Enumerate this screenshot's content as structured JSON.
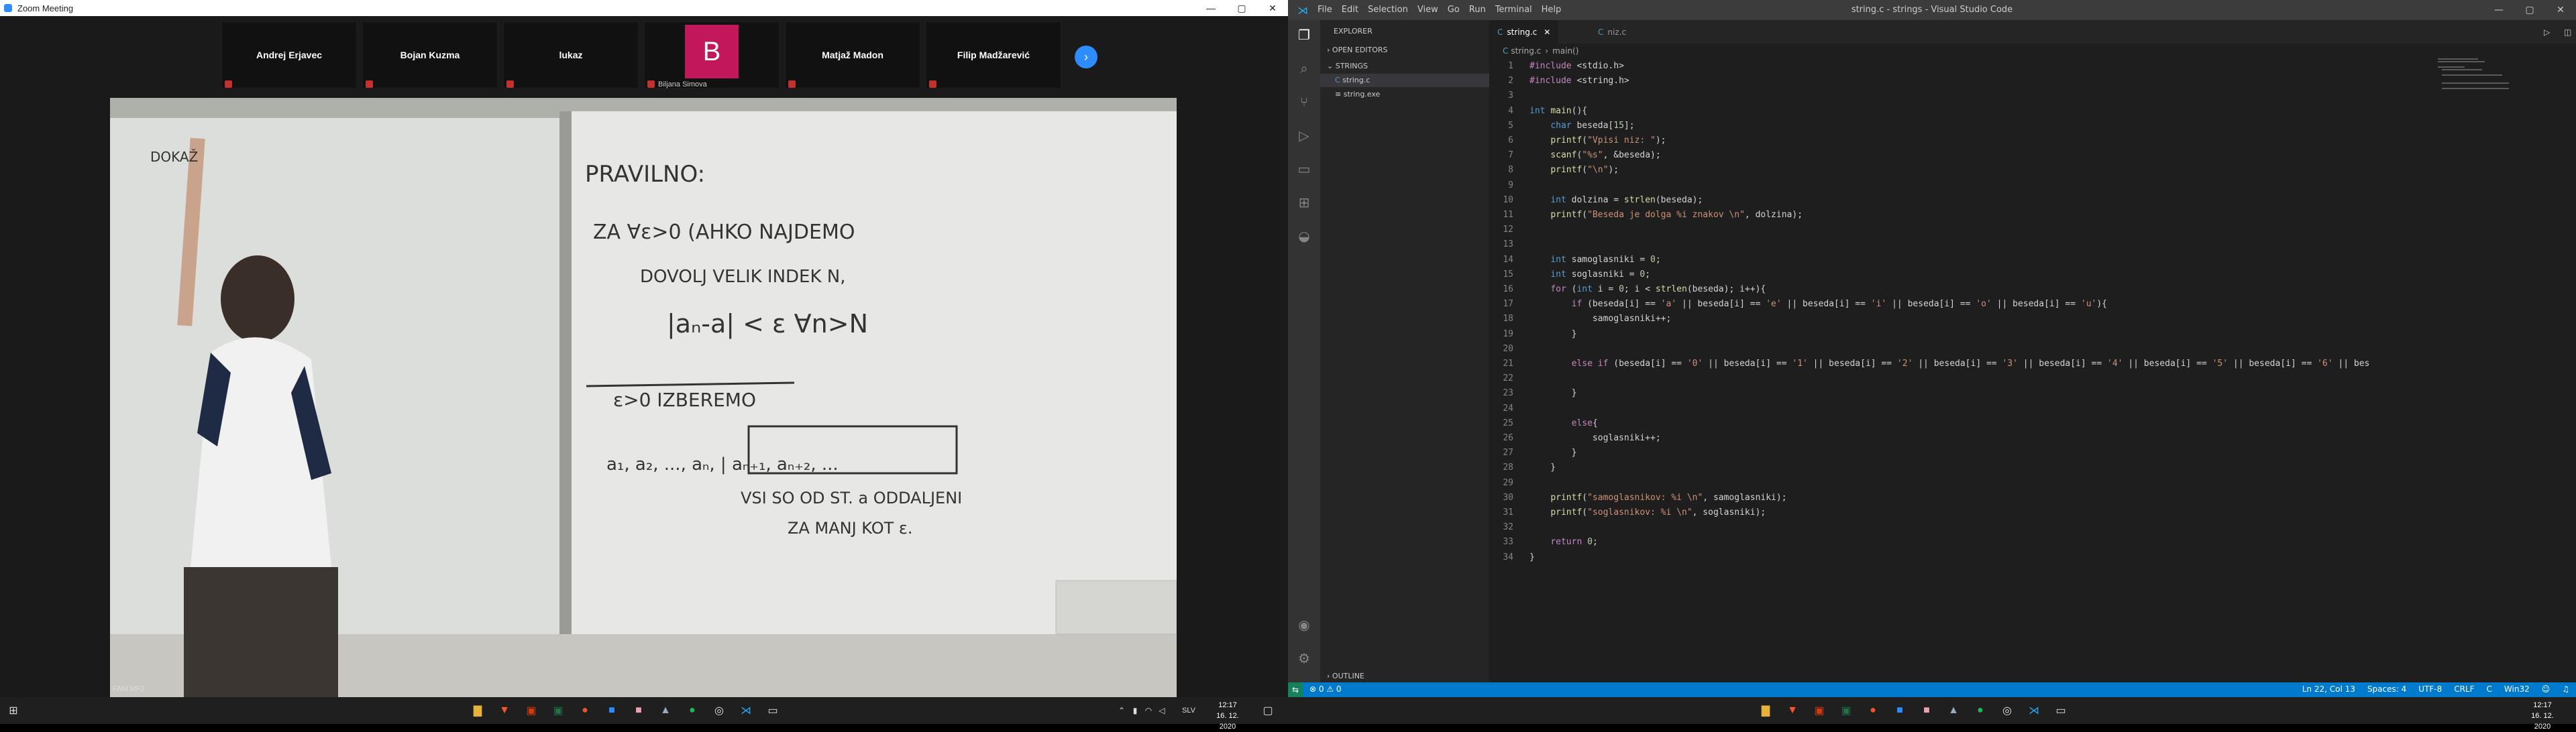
{
  "zoom": {
    "title": "Zoom Meeting",
    "participants": [
      {
        "name": "Andrej Erjavec"
      },
      {
        "name": "Bojan Kuzma"
      },
      {
        "name": "lukaz"
      },
      {
        "name": "Biljana Simova",
        "avatar_letter": "B"
      },
      {
        "name": "Matjaž Madon"
      },
      {
        "name": "Filip Madžarević"
      }
    ],
    "video_label": "FAM MF2",
    "board_text": {
      "left": "DOKAŽ",
      "pravilno": "PRAVILNO:",
      "line1": "ZA ∀ε>0 (AHKO NAJDEMO",
      "line2": "DOVOLJ VELIK INDEK N,",
      "line3": "|aₙ-a| < ε   ∀n>N",
      "line4": "ε>0 IZBEREMO",
      "line5": "a₁, a₂, ..., aₙ, | aₙ₊₁, aₙ₊₂, ...",
      "line6": "VSI SO OD ST. a ODDALJENI",
      "line7": "ZA MANJ KOT ε."
    }
  },
  "taskbar_left": {
    "clock_time": "12:17",
    "clock_date": "16. 12. 2020",
    "lang": "SLV"
  },
  "taskbar_right": {
    "clock_time": "12:17",
    "clock_date": "16. 12. 2020"
  },
  "vscode": {
    "window_title": "string.c - strings - Visual Studio Code",
    "menu": [
      "File",
      "Edit",
      "Selection",
      "View",
      "Go",
      "Run",
      "Terminal",
      "Help"
    ],
    "sidebar": {
      "header": "EXPLORER",
      "open_editors": "OPEN EDITORS",
      "folder": "STRINGS",
      "files": [
        "string.c",
        "string.exe"
      ],
      "outline": "OUTLINE"
    },
    "tabs": [
      {
        "label": "string.c"
      },
      {
        "label": "niz.c"
      }
    ],
    "breadcrumb": [
      "string.c",
      "main()"
    ],
    "code_lines": [
      "#include <stdio.h>",
      "#include <string.h>",
      "",
      "int main(){",
      "    char beseda[15];",
      "    printf(\"Vpisi niz: \");",
      "    scanf(\"%s\", &beseda);",
      "    printf(\"\\n\");",
      "",
      "    int dolzina = strlen(beseda);",
      "    printf(\"Beseda je dolga %i znakov \\n\", dolzina);",
      "",
      "",
      "    int samoglasniki = 0;",
      "    int soglasniki = 0;",
      "    for (int i = 0; i < strlen(beseda); i++){",
      "        if (beseda[i] == 'a' || beseda[i] == 'e' || beseda[i] == 'i' || beseda[i] == 'o' || beseda[i] == 'u'){",
      "            samoglasniki++;",
      "        }",
      "",
      "        else if (beseda[i] == '0' || beseda[i] == '1' || beseda[i] == '2' || beseda[i] == '3' || beseda[i] == '4' || beseda[i] == '5' || beseda[i] == '6' || bes",
      "",
      "        }",
      "",
      "        else{",
      "            soglasniki++;",
      "        }",
      "    }",
      "",
      "    printf(\"samoglasnikov: %i \\n\", samoglasniki);",
      "    printf(\"soglasnikov: %i \\n\", soglasniki);",
      "",
      "    return 0;",
      "}"
    ],
    "status": {
      "errors": "⊗ 0  ⚠ 0",
      "position": "Ln 22, Col 13",
      "spaces": "Spaces: 4",
      "encoding": "UTF-8",
      "eol": "CRLF",
      "language": "C",
      "platform": "Win32"
    }
  }
}
